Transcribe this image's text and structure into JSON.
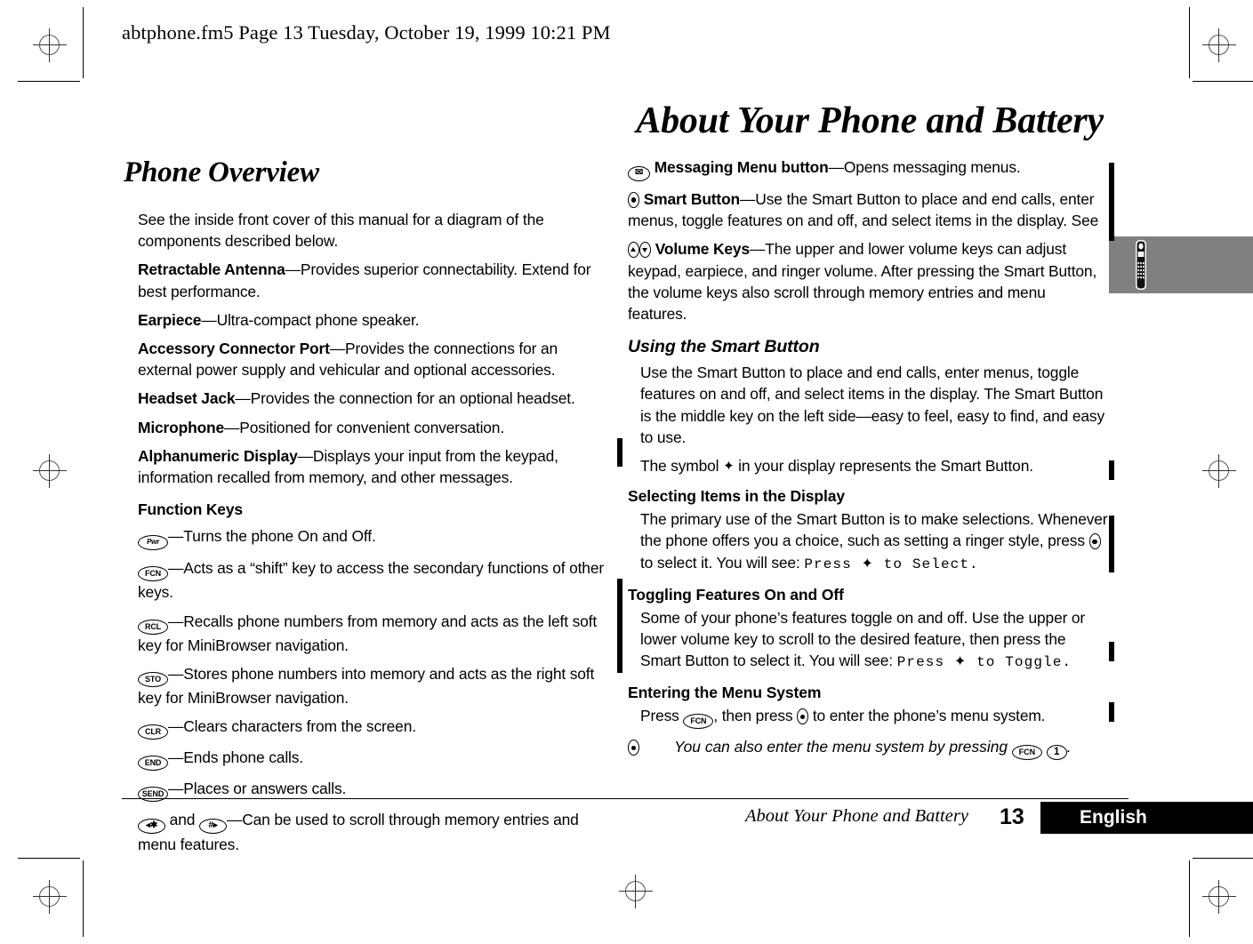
{
  "header": {
    "file_line": "abtphone.fm5  Page 13  Tuesday, October 19, 1999  10:21 PM"
  },
  "chapter_title": "About Your Phone and Battery",
  "left_column": {
    "section_title": "Phone Overview",
    "intro": "See the inside front cover of this manual for a diagram of the components described below.",
    "components": [
      {
        "term": "Retractable Antenna",
        "dash": "—",
        "desc": "Provides superior connectability. Extend for best performance."
      },
      {
        "term": "Earpiece",
        "dash": "—",
        "desc": "Ultra-compact phone speaker."
      },
      {
        "term": "Accessory Connector Port",
        "dash": "—",
        "desc": "Provides the connections for an external power supply and vehicular and optional accessories."
      },
      {
        "term": "Headset Jack",
        "dash": "—",
        "desc": "Provides the connection for an optional headset."
      },
      {
        "term": "Microphone",
        "dash": "—",
        "desc": "Positioned for convenient conversation."
      },
      {
        "term": "Alphanumeric Display",
        "dash": "—",
        "desc": "Displays your input from the keypad, information recalled from memory, and other messages."
      }
    ],
    "function_keys_heading": "Function Keys",
    "function_keys": [
      {
        "key_label": "Pwr",
        "key_icon": "power-key-icon",
        "dash": "—",
        "desc": "Turns the phone On and Off."
      },
      {
        "key_label": "FCN",
        "key_icon": "fcn-key-icon",
        "dash": "—",
        "desc": "Acts as a “shift” key to access the secondary functions of other keys."
      },
      {
        "key_label": "RCL",
        "key_icon": "rcl-key-icon",
        "dash": "—",
        "desc": "Recalls phone numbers from memory and acts as the left soft key for MiniBrowser navigation."
      },
      {
        "key_label": "STO",
        "key_icon": "sto-key-icon",
        "dash": "—",
        "desc": "Stores phone numbers into memory and acts as the right soft key for MiniBrowser navigation."
      },
      {
        "key_label": "CLR",
        "key_icon": "clr-key-icon",
        "dash": "—",
        "desc": "Clears characters from the screen."
      },
      {
        "key_label": "END",
        "key_icon": "end-key-icon",
        "dash": "—",
        "desc": "Ends phone calls."
      },
      {
        "key_label": "SEND",
        "key_icon": "send-key-icon",
        "dash": "—",
        "desc": "Places or answers calls."
      }
    ],
    "scroll_keys": {
      "star_label": "◂✱",
      "hash_label": "#▸",
      "joiner": " and ",
      "dash": "—",
      "desc": "Can be used to scroll through memory entries and menu features."
    }
  },
  "right_column": {
    "messaging": {
      "term": "Messaging Menu button",
      "dash": "—",
      "desc": "Opens messaging menus.",
      "icon": "envelope-key-icon",
      "icon_label": "✉"
    },
    "smart_button": {
      "term": "Smart Button",
      "dash": "—",
      "desc": "Use the Smart Button to place and end calls, enter menus, toggle features on and off, and select items in the display. See",
      "icon": "smart-button-icon"
    },
    "volume_keys": {
      "term": "Volume Keys",
      "dash": "—",
      "desc": "The upper and lower volume keys can adjust keypad, earpiece, and ringer volume. After pressing the Smart Button, the volume keys also scroll through memory entries and menu features.",
      "icon_up": "volume-up-key-icon",
      "icon_down": "volume-down-key-icon"
    },
    "using_smart_button": {
      "heading": "Using the Smart Button",
      "para1": "Use the Smart Button to place and end calls, enter menus, toggle features on and off, and select items in the display. The Smart Button is the middle key on the left side—easy to feel, easy to find, and easy to use.",
      "para2_pre": "The symbol ",
      "para2_symbol": "✦",
      "para2_post": " in your display represents the Smart Button."
    },
    "selecting_items": {
      "heading": "Selecting Items in the Display",
      "text_pre": "The primary use of the Smart Button is to make selections. Whenever the phone offers you a choice, such as setting a ringer style, press ",
      "text_mid": " to select it. You will see: ",
      "display_text": "Press ✦ to Select.",
      "text_post": ""
    },
    "toggling_features": {
      "heading": "Toggling Features On and Off",
      "text_pre": "Some of your phone’s features toggle on and off. Use the upper or lower volume key to scroll to the desired feature, then press the Smart Button to select it. You will see: ",
      "display_text": "Press ✦ to Toggle."
    },
    "entering_menu": {
      "heading": "Entering the Menu System",
      "press_word": "Press ",
      "fcn_label": "FCN",
      "mid_text": ", then press ",
      "post_text": " to enter the phone’s menu system.",
      "note_pre": "You can also enter the menu system by pressing ",
      "note_fcn_label": "FCN",
      "note_num_label": "1",
      "note_post": "."
    }
  },
  "thumb_tab": {
    "icon": "mobile-phone-icon"
  },
  "footer": {
    "running_head": "About Your Phone and Battery",
    "page_number": "13",
    "language": "English"
  },
  "colors": {
    "text": "#000000",
    "tab_gray": "#808080",
    "page_background": "#ffffff",
    "footer_bar": "#000000"
  }
}
